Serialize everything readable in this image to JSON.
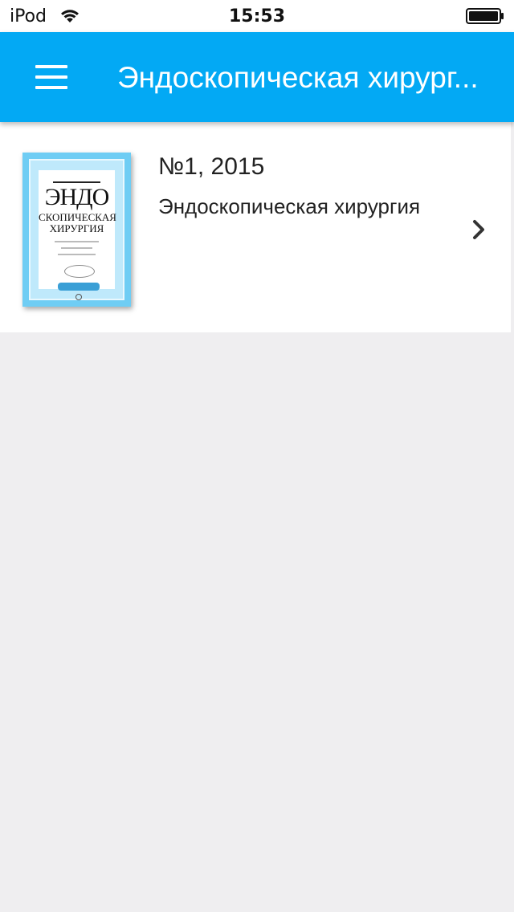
{
  "status_bar": {
    "carrier": "iPod",
    "time": "15:53",
    "wifi_icon": "wifi-icon",
    "battery_icon": "battery-full-icon"
  },
  "app_bar": {
    "menu_icon": "hamburger-menu-icon",
    "title": "Эндоскопическая хирург..."
  },
  "issues": [
    {
      "number": "№1, 2015",
      "journal": "Эндоскопическая хирургия",
      "cover": {
        "logo_top": "ЭНДО",
        "logo_bottom": "скопическая хирургия"
      },
      "chevron_icon": "chevron-right-icon"
    }
  ],
  "colors": {
    "accent": "#03a9f4",
    "background": "#efeef0",
    "card": "#ffffff",
    "cover_frame": "#6fcdf4"
  }
}
